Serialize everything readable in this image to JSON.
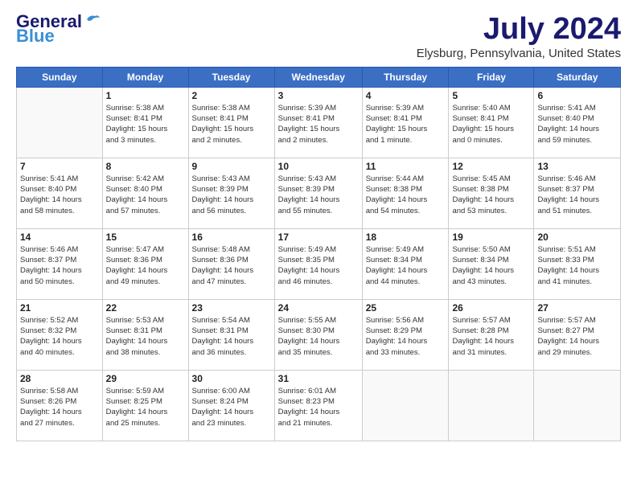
{
  "header": {
    "logo_general": "General",
    "logo_blue": "Blue",
    "month_title": "July 2024",
    "location": "Elysburg, Pennsylvania, United States"
  },
  "days_of_week": [
    "Sunday",
    "Monday",
    "Tuesday",
    "Wednesday",
    "Thursday",
    "Friday",
    "Saturday"
  ],
  "weeks": [
    [
      {
        "day": "",
        "info": ""
      },
      {
        "day": "1",
        "info": "Sunrise: 5:38 AM\nSunset: 8:41 PM\nDaylight: 15 hours\nand 3 minutes."
      },
      {
        "day": "2",
        "info": "Sunrise: 5:38 AM\nSunset: 8:41 PM\nDaylight: 15 hours\nand 2 minutes."
      },
      {
        "day": "3",
        "info": "Sunrise: 5:39 AM\nSunset: 8:41 PM\nDaylight: 15 hours\nand 2 minutes."
      },
      {
        "day": "4",
        "info": "Sunrise: 5:39 AM\nSunset: 8:41 PM\nDaylight: 15 hours\nand 1 minute."
      },
      {
        "day": "5",
        "info": "Sunrise: 5:40 AM\nSunset: 8:41 PM\nDaylight: 15 hours\nand 0 minutes."
      },
      {
        "day": "6",
        "info": "Sunrise: 5:41 AM\nSunset: 8:40 PM\nDaylight: 14 hours\nand 59 minutes."
      }
    ],
    [
      {
        "day": "7",
        "info": "Sunrise: 5:41 AM\nSunset: 8:40 PM\nDaylight: 14 hours\nand 58 minutes."
      },
      {
        "day": "8",
        "info": "Sunrise: 5:42 AM\nSunset: 8:40 PM\nDaylight: 14 hours\nand 57 minutes."
      },
      {
        "day": "9",
        "info": "Sunrise: 5:43 AM\nSunset: 8:39 PM\nDaylight: 14 hours\nand 56 minutes."
      },
      {
        "day": "10",
        "info": "Sunrise: 5:43 AM\nSunset: 8:39 PM\nDaylight: 14 hours\nand 55 minutes."
      },
      {
        "day": "11",
        "info": "Sunrise: 5:44 AM\nSunset: 8:38 PM\nDaylight: 14 hours\nand 54 minutes."
      },
      {
        "day": "12",
        "info": "Sunrise: 5:45 AM\nSunset: 8:38 PM\nDaylight: 14 hours\nand 53 minutes."
      },
      {
        "day": "13",
        "info": "Sunrise: 5:46 AM\nSunset: 8:37 PM\nDaylight: 14 hours\nand 51 minutes."
      }
    ],
    [
      {
        "day": "14",
        "info": "Sunrise: 5:46 AM\nSunset: 8:37 PM\nDaylight: 14 hours\nand 50 minutes."
      },
      {
        "day": "15",
        "info": "Sunrise: 5:47 AM\nSunset: 8:36 PM\nDaylight: 14 hours\nand 49 minutes."
      },
      {
        "day": "16",
        "info": "Sunrise: 5:48 AM\nSunset: 8:36 PM\nDaylight: 14 hours\nand 47 minutes."
      },
      {
        "day": "17",
        "info": "Sunrise: 5:49 AM\nSunset: 8:35 PM\nDaylight: 14 hours\nand 46 minutes."
      },
      {
        "day": "18",
        "info": "Sunrise: 5:49 AM\nSunset: 8:34 PM\nDaylight: 14 hours\nand 44 minutes."
      },
      {
        "day": "19",
        "info": "Sunrise: 5:50 AM\nSunset: 8:34 PM\nDaylight: 14 hours\nand 43 minutes."
      },
      {
        "day": "20",
        "info": "Sunrise: 5:51 AM\nSunset: 8:33 PM\nDaylight: 14 hours\nand 41 minutes."
      }
    ],
    [
      {
        "day": "21",
        "info": "Sunrise: 5:52 AM\nSunset: 8:32 PM\nDaylight: 14 hours\nand 40 minutes."
      },
      {
        "day": "22",
        "info": "Sunrise: 5:53 AM\nSunset: 8:31 PM\nDaylight: 14 hours\nand 38 minutes."
      },
      {
        "day": "23",
        "info": "Sunrise: 5:54 AM\nSunset: 8:31 PM\nDaylight: 14 hours\nand 36 minutes."
      },
      {
        "day": "24",
        "info": "Sunrise: 5:55 AM\nSunset: 8:30 PM\nDaylight: 14 hours\nand 35 minutes."
      },
      {
        "day": "25",
        "info": "Sunrise: 5:56 AM\nSunset: 8:29 PM\nDaylight: 14 hours\nand 33 minutes."
      },
      {
        "day": "26",
        "info": "Sunrise: 5:57 AM\nSunset: 8:28 PM\nDaylight: 14 hours\nand 31 minutes."
      },
      {
        "day": "27",
        "info": "Sunrise: 5:57 AM\nSunset: 8:27 PM\nDaylight: 14 hours\nand 29 minutes."
      }
    ],
    [
      {
        "day": "28",
        "info": "Sunrise: 5:58 AM\nSunset: 8:26 PM\nDaylight: 14 hours\nand 27 minutes."
      },
      {
        "day": "29",
        "info": "Sunrise: 5:59 AM\nSunset: 8:25 PM\nDaylight: 14 hours\nand 25 minutes."
      },
      {
        "day": "30",
        "info": "Sunrise: 6:00 AM\nSunset: 8:24 PM\nDaylight: 14 hours\nand 23 minutes."
      },
      {
        "day": "31",
        "info": "Sunrise: 6:01 AM\nSunset: 8:23 PM\nDaylight: 14 hours\nand 21 minutes."
      },
      {
        "day": "",
        "info": ""
      },
      {
        "day": "",
        "info": ""
      },
      {
        "day": "",
        "info": ""
      }
    ]
  ]
}
